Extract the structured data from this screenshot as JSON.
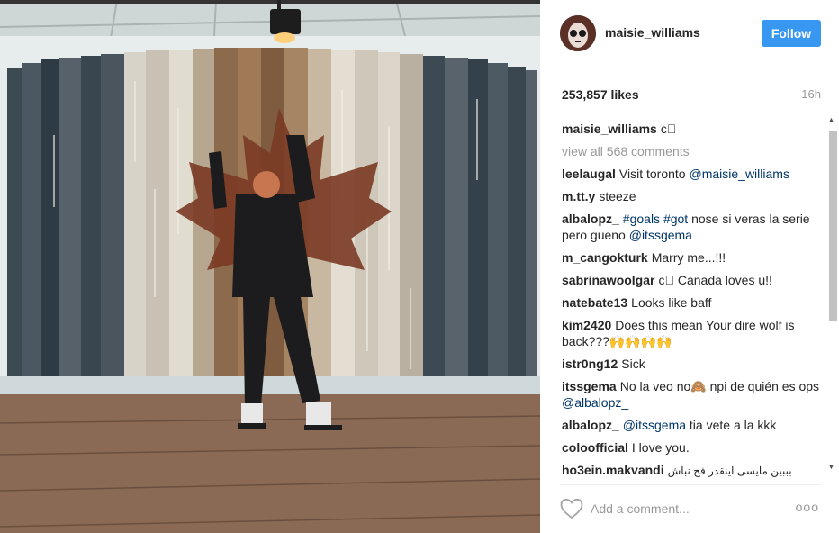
{
  "post": {
    "username": "maisie_williams",
    "follow_label": "Follow",
    "likes": "253,857 likes",
    "time": "16h"
  },
  "comments": {
    "caption": {
      "user": "maisie_williams",
      "text": "c⃞"
    },
    "view_all": "view all 568 comments",
    "items": [
      {
        "user": "leelaugal",
        "text": "Visit toronto ",
        "tag": "@maisie_williams"
      },
      {
        "user": "m.tt.y",
        "text": "steeze"
      },
      {
        "user": "albalopz_",
        "tag1": "#goals",
        "tag2": "#got",
        "text": " nose si veras la serie pero gueno ",
        "tag3": "@itssgema"
      },
      {
        "user": "m_cangokturk",
        "text": "Marry me...!!!"
      },
      {
        "user": "sabrinawoolgar",
        "text": "c⃞ Canada loves u!!"
      },
      {
        "user": "natebate13",
        "text": "Looks like baff"
      },
      {
        "user": "kim2420",
        "text": "Does this mean Your dire wolf is back???🙌🙌🙌🙌"
      },
      {
        "user": "istr0ng12",
        "text": "Sick"
      },
      {
        "user": "itssgema",
        "text": "No la veo no🙈 npi de quién es ops ",
        "tag": "@albalopz_"
      },
      {
        "user": "albalopz_",
        "tag": "@itssgema",
        "text": " tia vete a la kkk"
      },
      {
        "user": "coloofficial",
        "text": "I love you."
      },
      {
        "user": "ho3ein.makvandi",
        "text": "بببین مایسی اینقدر فح نباش"
      }
    ]
  },
  "footer": {
    "add_comment_placeholder": "Add a comment...",
    "more_label": "ooo"
  },
  "icons": {
    "heart": "heart-icon",
    "more": "more-options-icon"
  },
  "colors": {
    "follow_button": "#3897f0",
    "hashtag": "#003569",
    "muted": "#999999"
  }
}
